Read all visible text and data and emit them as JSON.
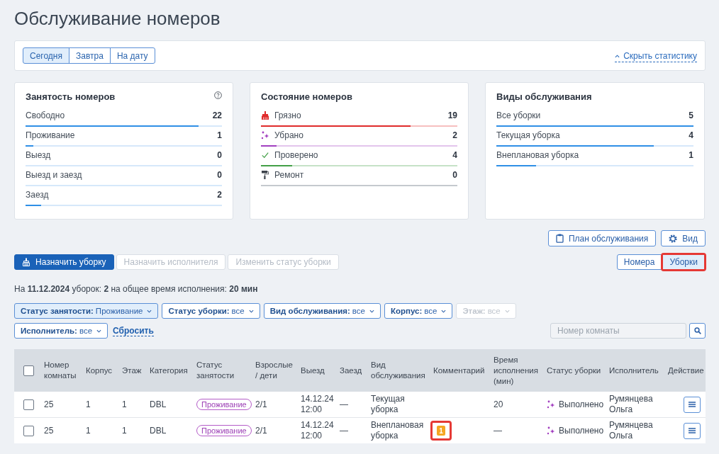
{
  "page_title": "Обслуживание номеров",
  "period_tabs": [
    {
      "label": "Сегодня",
      "selected": true
    },
    {
      "label": "Завтра",
      "selected": false
    },
    {
      "label": "На дату",
      "selected": false
    }
  ],
  "hide_stats_link": "Скрыть статистику",
  "stat_cards": [
    {
      "title": "Занятость номеров",
      "help": true,
      "rows": [
        {
          "label": "Свободно",
          "value": "22",
          "level": 0.88
        },
        {
          "label": "Проживание",
          "value": "1",
          "level": 0.04
        },
        {
          "label": "Выезд",
          "value": "0",
          "level": 0
        },
        {
          "label": "Выезд и заезд",
          "value": "0",
          "level": 0
        },
        {
          "label": "Заезд",
          "value": "2",
          "level": 0.08
        }
      ]
    },
    {
      "title": "Состояние номеров",
      "rows": [
        {
          "kind": "dirty",
          "label": "Грязно",
          "value": "19",
          "level": 0.76,
          "color": "#e02b2b"
        },
        {
          "kind": "cleaned",
          "label": "Убрано",
          "value": "2",
          "level": 0.08,
          "color": "#a23fc0"
        },
        {
          "kind": "inspected",
          "label": "Проверено",
          "value": "4",
          "level": 0.16,
          "color": "#43a047"
        },
        {
          "kind": "repair",
          "label": "Ремонт",
          "value": "0",
          "level": 0,
          "color": "#c5c9ce"
        }
      ]
    },
    {
      "title": "Виды обслуживания",
      "rows": [
        {
          "label": "Все уборки",
          "value": "5",
          "level": 1
        },
        {
          "label": "Текущая уборка",
          "value": "4",
          "level": 0.8
        },
        {
          "label": "Внеплановая уборка",
          "value": "1",
          "level": 0.2
        }
      ]
    }
  ],
  "toolbar_buttons": [
    {
      "kind": "plan",
      "label": "План обслуживания"
    },
    {
      "kind": "view",
      "label": "Вид"
    }
  ],
  "action_buttons": [
    {
      "kind": "primary",
      "label": "Назначить уборку",
      "disabled": false
    },
    {
      "kind": "outline",
      "label": "Назначить исполнителя",
      "disabled": true
    },
    {
      "kind": "outline",
      "label": "Изменить статус уборки",
      "disabled": true
    }
  ],
  "view_toggle": [
    {
      "label": "Номера",
      "selected": false,
      "highlighted": false
    },
    {
      "label": "Уборки",
      "selected": true,
      "highlighted": true
    }
  ],
  "summary": "На **11.12.2024** уборок: **2** на общее время исполнения: **20 мин**",
  "filters": [
    {
      "label": "Статус занятости:",
      "value": "Проживание",
      "active": true,
      "disabled": false
    },
    {
      "label": "Статус уборки:",
      "value": "все",
      "active": false,
      "disabled": false
    },
    {
      "label": "Вид обслуживания:",
      "value": "все",
      "active": false,
      "disabled": false
    },
    {
      "label": "Корпус:",
      "value": "все",
      "active": false,
      "disabled": false
    },
    {
      "label": "Этаж:",
      "value": "все",
      "active": false,
      "disabled": true
    },
    {
      "label": "Исполнитель:",
      "value": "все",
      "active": false,
      "disabled": false
    }
  ],
  "reset_link": "Сбросить",
  "search": {
    "placeholder": "Номер комнаты"
  },
  "table": {
    "select_all_checked": false,
    "columns": [
      "Номер комнаты",
      "Корпус",
      "Этаж",
      "Категория",
      "Статус занятости",
      "Взрослые / дети",
      "Выезд",
      "Заезд",
      "Вид обслуживания",
      "Комментарий",
      "Время исполнения (мин)",
      "Статус уборки",
      "Исполнитель",
      "Действие"
    ],
    "rows": [
      {
        "checked": false,
        "room": "25",
        "building": "1",
        "floor": "1",
        "category": "DBL",
        "occupancy": "Проживание",
        "guests": "2/1",
        "departure": "14.12.24 12:00",
        "arrival": "—",
        "service": "Текущая уборка",
        "duration": "20",
        "cleaning_status": "Выполнено",
        "assignee": "Румянцева Ольга"
      },
      {
        "checked": false,
        "room": "25",
        "building": "1",
        "floor": "1",
        "category": "DBL",
        "occupancy": "Проживание",
        "guests": "2/1",
        "departure": "14.12.24 12:00",
        "arrival": "—",
        "service": "Внеплановая уборка",
        "comment": {
          "count": "1",
          "highlighted": true
        },
        "duration": "—",
        "cleaning_status": "Выполнено",
        "assignee": "Румянцева Ольга"
      }
    ]
  }
}
